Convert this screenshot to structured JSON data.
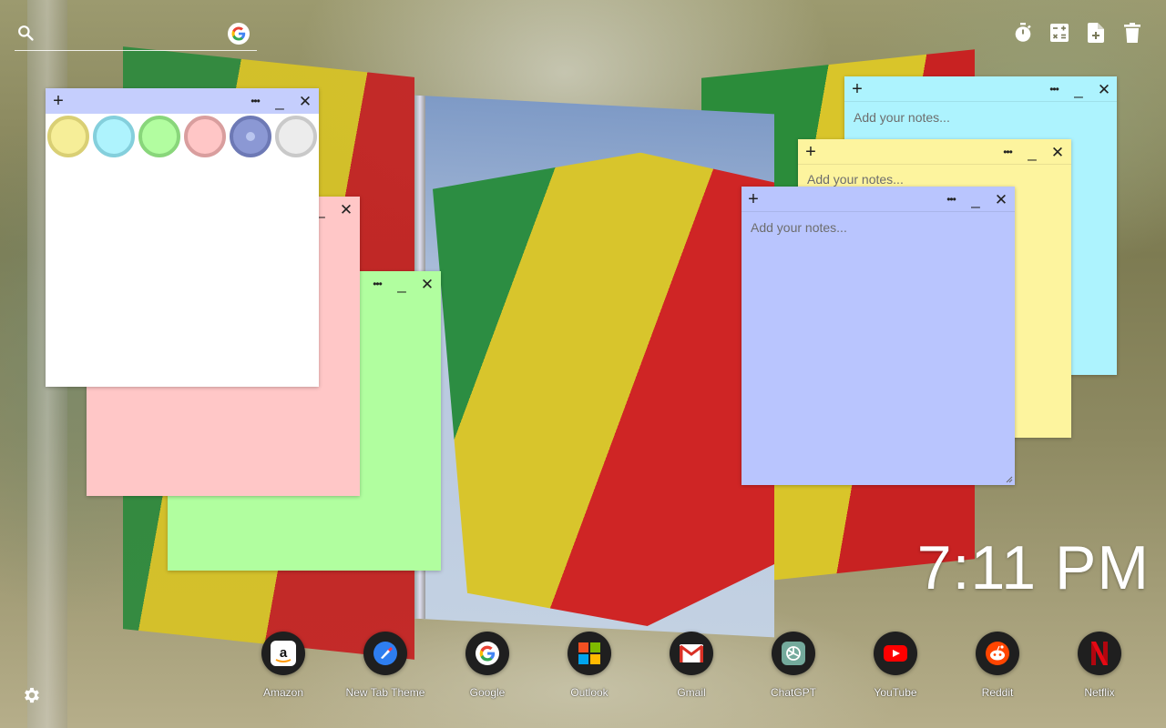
{
  "search": {
    "placeholder": "",
    "engine_icon": "google-icon"
  },
  "toolbar": {
    "tools": [
      {
        "name": "timer-icon"
      },
      {
        "name": "calculator-icon"
      },
      {
        "name": "new-note-icon"
      },
      {
        "name": "trash-icon"
      }
    ]
  },
  "notes": {
    "controls": {
      "add": "+",
      "more": "•••",
      "minimize": "_",
      "close": "✕"
    },
    "placeholder": "Add your notes...",
    "colors": {
      "white": "#ffffff",
      "pink": "#ffc7c7",
      "green": "#b1fe9f",
      "cyan": "#adf3fe",
      "yellow": "#fdf49e",
      "blue": "#b9c5fe",
      "bar_white": "#c5cefd",
      "bar_pink": "#ffc7c7",
      "bar_green": "#b1fe9f"
    },
    "palette": [
      {
        "name": "yellow",
        "color": "#f6ee98",
        "border": "#d9cf74"
      },
      {
        "name": "cyan",
        "color": "#aef3fd",
        "border": "#84cfdc"
      },
      {
        "name": "green",
        "color": "#b2fda0",
        "border": "#89d67b"
      },
      {
        "name": "pink",
        "color": "#ffc6c6",
        "border": "#d99e9e"
      },
      {
        "name": "blue",
        "color": "#8b98d4",
        "border": "#6d79b5"
      },
      {
        "name": "grey",
        "color": "#ececec",
        "border": "#c9c9c9"
      }
    ]
  },
  "clock": {
    "time": "7:11 PM"
  },
  "dock": {
    "items": [
      {
        "label": "Amazon",
        "icon": "amazon-icon"
      },
      {
        "label": "New Tab Theme",
        "icon": "new-tab-theme-icon"
      },
      {
        "label": "Google",
        "icon": "google-icon"
      },
      {
        "label": "Outlook",
        "icon": "outlook-icon"
      },
      {
        "label": "Gmail",
        "icon": "gmail-icon"
      },
      {
        "label": "ChatGPT",
        "icon": "chatgpt-icon"
      },
      {
        "label": "YouTube",
        "icon": "youtube-icon"
      },
      {
        "label": "Reddit",
        "icon": "reddit-icon"
      },
      {
        "label": "Netflix",
        "icon": "netflix-icon"
      }
    ]
  },
  "settings": {
    "icon": "gear-icon"
  }
}
